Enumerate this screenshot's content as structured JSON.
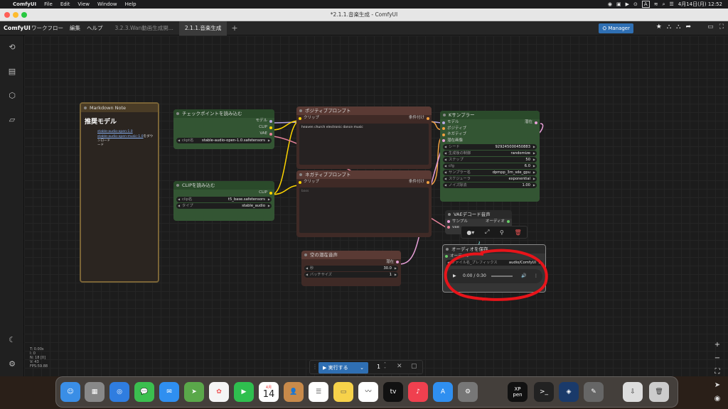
{
  "menubar": {
    "app": "ComfyUI",
    "items": [
      "File",
      "Edit",
      "View",
      "Window",
      "Help"
    ],
    "clock": "4月14日(月) 12:52",
    "input_indicator": "A"
  },
  "window": {
    "title": "*2.1.1.音楽生成 - ComfyUI"
  },
  "appbar": {
    "logo": "ComfyUI",
    "menus": [
      "ワークフロー",
      "編集",
      "ヘルプ"
    ],
    "tabs": [
      "3.2.3.Wan動画生成開...",
      "2.1.1.音楽生成"
    ],
    "manager": "Manager"
  },
  "colors": {
    "accent": "#2f6fb3",
    "node_green": "#335533",
    "node_brown": "#3f2a26",
    "annotation_red": "#e8141a"
  },
  "nodes": {
    "markdown": {
      "title": "Markdown Note",
      "heading": "推奨モデル",
      "links": [
        "stable-audio-open-1.0",
        "stable-audio-open-music-1.0"
      ],
      "suffix": "をダウンロード",
      "suffix2": "ード"
    },
    "checkpoint": {
      "title": "チェックポイントを読み込む",
      "outputs": [
        "モデル",
        "CLIP",
        "VAE"
      ],
      "widget_label": "ckpt名",
      "widget_value": "stable-audio-open-1.0.safetensors"
    },
    "clip": {
      "title": "CLIPを読み込む",
      "output": "CLIP",
      "w1_label": "clip名",
      "w1_value": "t5_base.safetensors",
      "w2_label": "タイプ",
      "w2_value": "stable_audio"
    },
    "positive": {
      "title": "ポジティブプロンプト",
      "input": "クリップ",
      "output": "条件付け",
      "text": "heaven church electronic dance music"
    },
    "negative": {
      "title": "ネガティブプロンプト",
      "input": "クリップ",
      "output": "条件付け",
      "text": "bass"
    },
    "ksampler": {
      "title": "Kサンプラー",
      "inputs": [
        "モデル",
        "ポジティブ",
        "ネガティブ",
        "潜在画像"
      ],
      "output": "潜在",
      "widgets": [
        [
          "シード",
          "929245000450883"
        ],
        [
          "生成後の制御",
          "randomize"
        ],
        [
          "ステップ",
          "50"
        ],
        [
          "cfg",
          "6.0"
        ],
        [
          "サンプラー名",
          "dpmpp_3m_sde_gpu"
        ],
        [
          "スケジューラ",
          "exponential"
        ],
        [
          "ノイズ除去",
          "1.00"
        ]
      ]
    },
    "vae": {
      "title": "VAEデコード音声",
      "in1": "サンプル",
      "in2": "vae",
      "output": "オーディオ"
    },
    "latent": {
      "title": "空の潜在音声",
      "output": "潜在",
      "w1_label": "秒",
      "w1_value": "30.0",
      "w2_label": "バッチサイズ",
      "w2_value": "1"
    },
    "save": {
      "title": "オーディオを保存",
      "input": "オーディオ",
      "w_label": "ファイル名_プレフィックス",
      "w_value": "audio/ComfyUI",
      "time": "0:00 / 0:30"
    }
  },
  "stats": [
    "T: 0.00s",
    "I: 0",
    "N: 18 [0]",
    "V: 43",
    "FPS:59.88"
  ],
  "runbar": {
    "label": "実行する",
    "count": "1"
  },
  "dock": {
    "calendar_month": "4月",
    "calendar_day": "14",
    "xppen": "XP\npen"
  }
}
